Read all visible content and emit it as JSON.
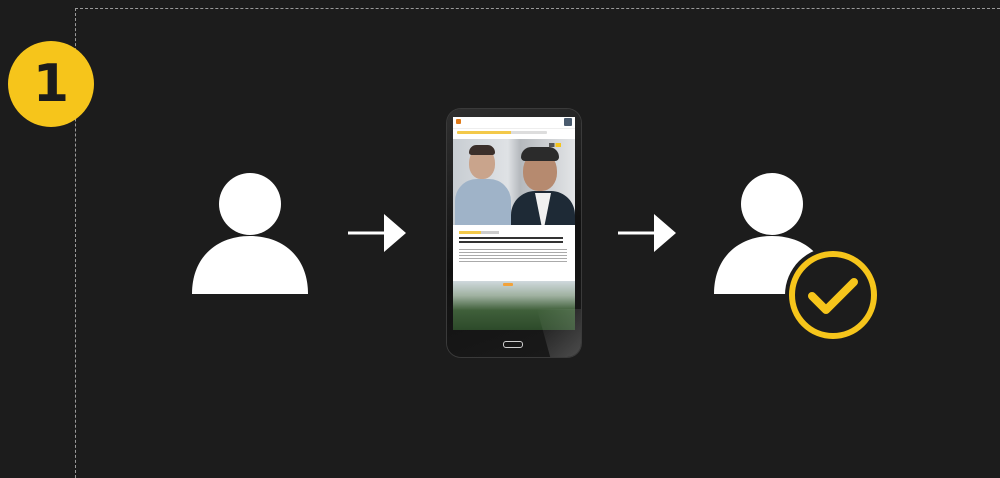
{
  "step": {
    "number": "1"
  },
  "icons": {
    "user_source": "user-icon",
    "arrow": "arrow-right-icon",
    "device": "smartphone-icon",
    "user_target": "user-icon",
    "check": "check-circle-icon"
  },
  "colors": {
    "background": "#1c1c1c",
    "accent": "#f6c51b",
    "icon": "#ffffff",
    "frame": "#9a9a9a"
  }
}
